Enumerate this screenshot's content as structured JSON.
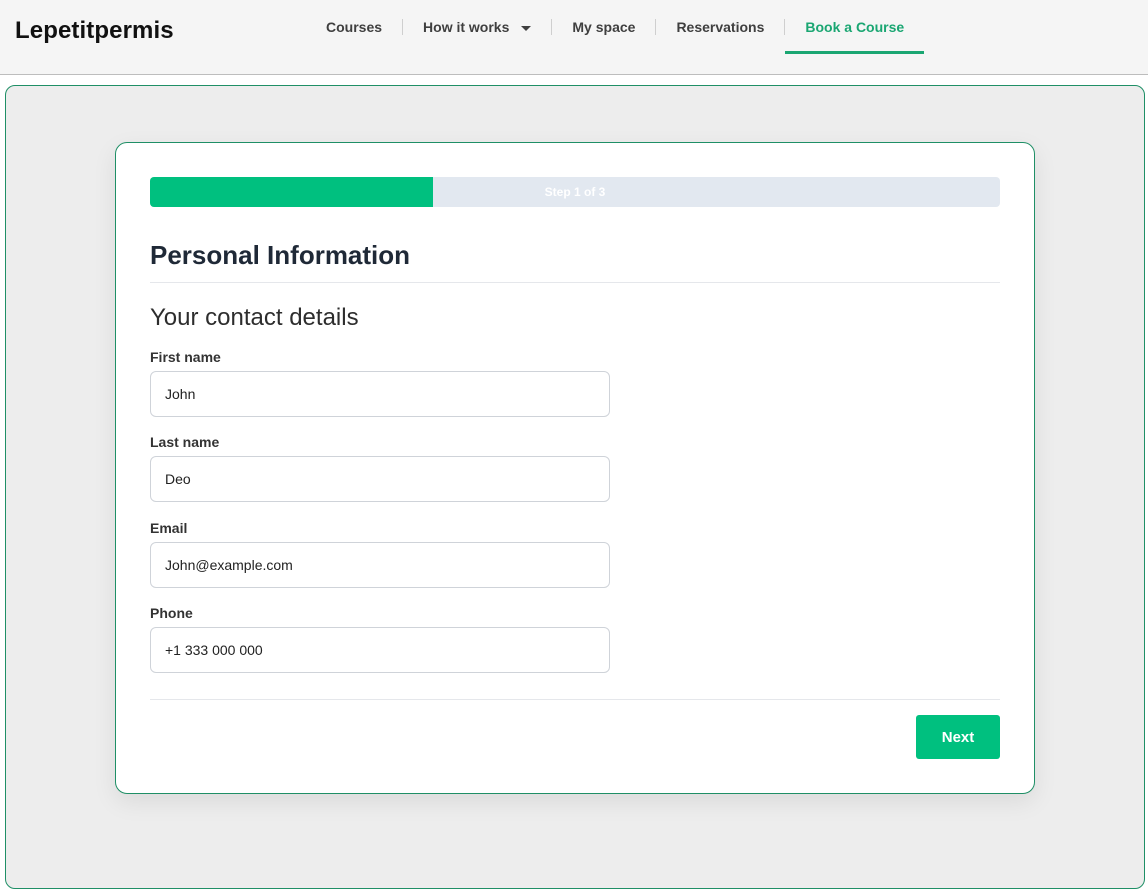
{
  "header": {
    "brand": "Lepetitpermis",
    "nav": [
      {
        "label": "Courses"
      },
      {
        "label": "How it works"
      },
      {
        "label": "My space"
      },
      {
        "label": "Reservations"
      },
      {
        "label": "Book a Course"
      }
    ],
    "active_nav": "Book a Course"
  },
  "progress": {
    "label": "Step 1 of 3",
    "current_step": 1,
    "total_steps": 3
  },
  "form": {
    "section_title": "Personal Information",
    "subsection_title": "Your contact details",
    "fields": [
      {
        "label": "First name",
        "value": "John"
      },
      {
        "label": "Last name",
        "value": "Deo"
      },
      {
        "label": "Email",
        "value": "John@example.com"
      },
      {
        "label": "Phone",
        "value": "+1 333 000 000"
      }
    ],
    "next_label": "Next"
  },
  "colors": {
    "accent": "#00c07f",
    "accent_text": "#1aa672",
    "border": "#1f8f66",
    "progress_track": "#e2e8f0"
  }
}
